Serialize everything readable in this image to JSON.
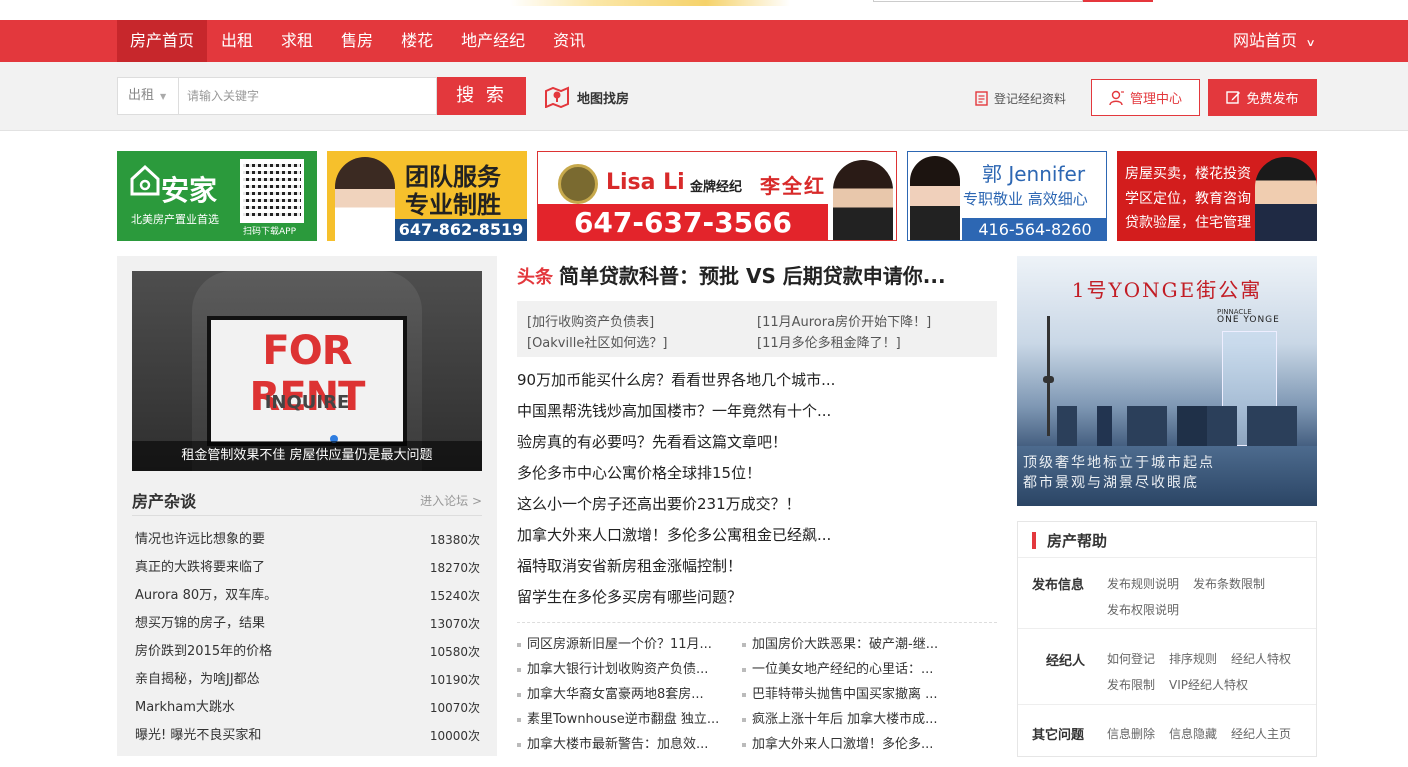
{
  "colors": {
    "brand_red": "#e3383d",
    "nav_active": "#c7272c"
  },
  "nav": {
    "items": [
      "房产首页",
      "出租",
      "求租",
      "售房",
      "楼花",
      "地产经纪",
      "资讯"
    ],
    "right": "网站首页"
  },
  "search": {
    "category": "出租",
    "placeholder": "请输入关键字",
    "button": "搜 索",
    "map_find": "地图找房",
    "register_agent": "登记经纪资料",
    "manage": "管理中心",
    "publish": "免费发布"
  },
  "banners": {
    "b1": {
      "brand": "安家",
      "tagline": "北美房产置业首选",
      "scan": "扫码下载APP"
    },
    "b2": {
      "line1": "团队服务",
      "line2": "专业制胜",
      "phone": "647-862-8519"
    },
    "b3": {
      "emblem": "HOMELIFE",
      "name": "Lisa Li",
      "title": "金牌经纪",
      "cname": "李全红",
      "phone": "647-637-3566"
    },
    "b4": {
      "name": "郭 Jennifer",
      "slogan": "专职敬业 高效细心",
      "phone": "416-564-8260"
    },
    "b5": {
      "lines": [
        "房屋买卖，楼花投资",
        "学区定位，教育咨询",
        "贷款验屋，住宅管理"
      ]
    }
  },
  "feature": {
    "sign_text": "FOR RENT",
    "sign_sub": "INQUIRE",
    "caption": "租金管制效果不佳 房屋供应量仍是最大问题"
  },
  "forum": {
    "title": "房产杂谈",
    "more": "进入论坛 >",
    "rows": [
      {
        "title": "情况也许远比想象的要",
        "count": "18380次"
      },
      {
        "title": "真正的大跌将要来临了",
        "count": "18270次"
      },
      {
        "title": "Aurora 80万，双车库。",
        "count": "15240次"
      },
      {
        "title": "想买万锦的房子，结果",
        "count": "13070次"
      },
      {
        "title": "房价跌到2015年的价格",
        "count": "10580次"
      },
      {
        "title": "亲自揭秘，为啥JJ都怂",
        "count": "10190次"
      },
      {
        "title": "Markham大跳水",
        "count": "10070次"
      },
      {
        "title": "曝光! 曝光不良买家和",
        "count": "10000次"
      }
    ]
  },
  "headline": {
    "tag": "头条",
    "title": "简单贷款科普：预批 VS 后期贷款申请你..."
  },
  "sub_links": [
    "[加行收购资产负债表]",
    "[11月Aurora房价开始下降！]",
    "[Oakville社区如何选？]",
    "[11月多伦多租金降了！]"
  ],
  "news": [
    "90万加币能买什么房？看看世界各地几个城市...",
    "中国黑帮洗钱炒高加国楼市？一年竟然有十个...",
    "验房真的有必要吗？先看看这篇文章吧！",
    "多伦多市中心公寓价格全球排15位！",
    "这么小一个房子还高出要价231万成交？！",
    "加拿大外来人口激增！多伦多公寓租金已经飙...",
    "福特取消安省新房租金涨幅控制！",
    "留学生在多伦多买房有哪些问题？"
  ],
  "more_news": [
    "同区房源新旧屋一个价？11月...",
    "加国房价大跌恶果：破产潮-继...",
    "加拿大银行计划收购资产负债...",
    "一位美女地产经纪的心里话：...",
    "加拿大华裔女富豪两地8套房...",
    "巴菲特带头抛售中国买家撤离 ...",
    "素里Townhouse逆市翻盘 独立...",
    "疯涨上涨十年后 加拿大楼市成...",
    "加拿大楼市最新警告：加息效...",
    "加拿大外来人口激增！多伦多..."
  ],
  "ad": {
    "title": "1号YONGE街公寓",
    "brand_top": "PINNACLE",
    "brand": "ONE YONGE",
    "slogan1": "顶级奢华地标立于城市起点",
    "slogan2": "都市景观与湖景尽收眼底"
  },
  "help": {
    "title": "房产帮助",
    "sections": [
      {
        "label": "发布信息",
        "links": [
          "发布规则说明",
          "发布条数限制",
          "发布权限说明"
        ]
      },
      {
        "label": "经纪人",
        "links": [
          "如何登记",
          "排序规则",
          "经纪人特权",
          "发布限制",
          "VIP经纪人特权"
        ]
      },
      {
        "label": "其它问题",
        "links": [
          "信息删除",
          "信息隐藏",
          "经纪人主页"
        ]
      }
    ]
  }
}
